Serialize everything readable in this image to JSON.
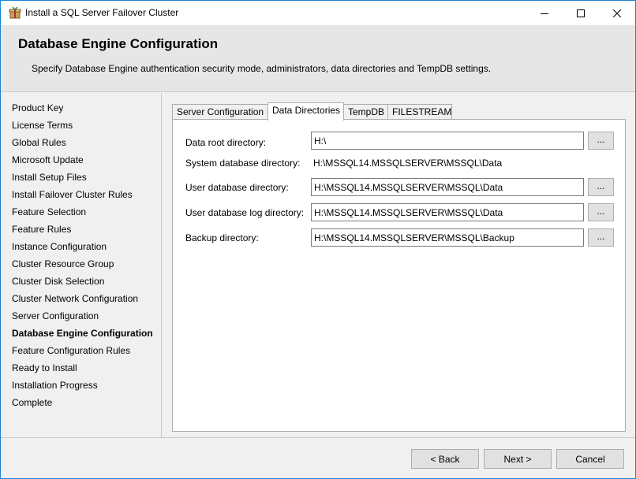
{
  "window": {
    "title": "Install a SQL Server Failover Cluster",
    "icons": {
      "app": "installer-box-icon",
      "minimize": "minimize-icon",
      "maximize": "maximize-icon",
      "close": "close-icon"
    }
  },
  "header": {
    "title": "Database Engine Configuration",
    "description": "Specify Database Engine authentication security mode, administrators, data directories and TempDB settings."
  },
  "sidebar": {
    "items": [
      {
        "label": "Product Key"
      },
      {
        "label": "License Terms"
      },
      {
        "label": "Global Rules"
      },
      {
        "label": "Microsoft Update"
      },
      {
        "label": "Install Setup Files"
      },
      {
        "label": "Install Failover Cluster Rules"
      },
      {
        "label": "Feature Selection"
      },
      {
        "label": "Feature Rules"
      },
      {
        "label": "Instance Configuration"
      },
      {
        "label": "Cluster Resource Group"
      },
      {
        "label": "Cluster Disk Selection"
      },
      {
        "label": "Cluster Network Configuration"
      },
      {
        "label": "Server Configuration"
      },
      {
        "label": "Database Engine Configuration"
      },
      {
        "label": "Feature Configuration Rules"
      },
      {
        "label": "Ready to Install"
      },
      {
        "label": "Installation Progress"
      },
      {
        "label": "Complete"
      }
    ],
    "active_index": 13
  },
  "tabs": [
    {
      "label": "Server Configuration"
    },
    {
      "label": "Data Directories"
    },
    {
      "label": "TempDB"
    },
    {
      "label": "FILESTREAM"
    }
  ],
  "active_tab": 1,
  "directories": {
    "data_root": {
      "label": "Data root directory:",
      "value": "H:\\"
    },
    "system_db": {
      "label": "System database directory:",
      "value": "H:\\MSSQL14.MSSQLSERVER\\MSSQL\\Data"
    },
    "user_db": {
      "label": "User database directory:",
      "value": "H:\\MSSQL14.MSSQLSERVER\\MSSQL\\Data"
    },
    "user_db_log": {
      "label": "User database log directory:",
      "value": "H:\\MSSQL14.MSSQLSERVER\\MSSQL\\Data"
    },
    "backup": {
      "label": "Backup directory:",
      "value": "H:\\MSSQL14.MSSQLSERVER\\MSSQL\\Backup"
    },
    "browse_label": "..."
  },
  "footer": {
    "back": "< Back",
    "next": "Next >",
    "cancel": "Cancel"
  }
}
